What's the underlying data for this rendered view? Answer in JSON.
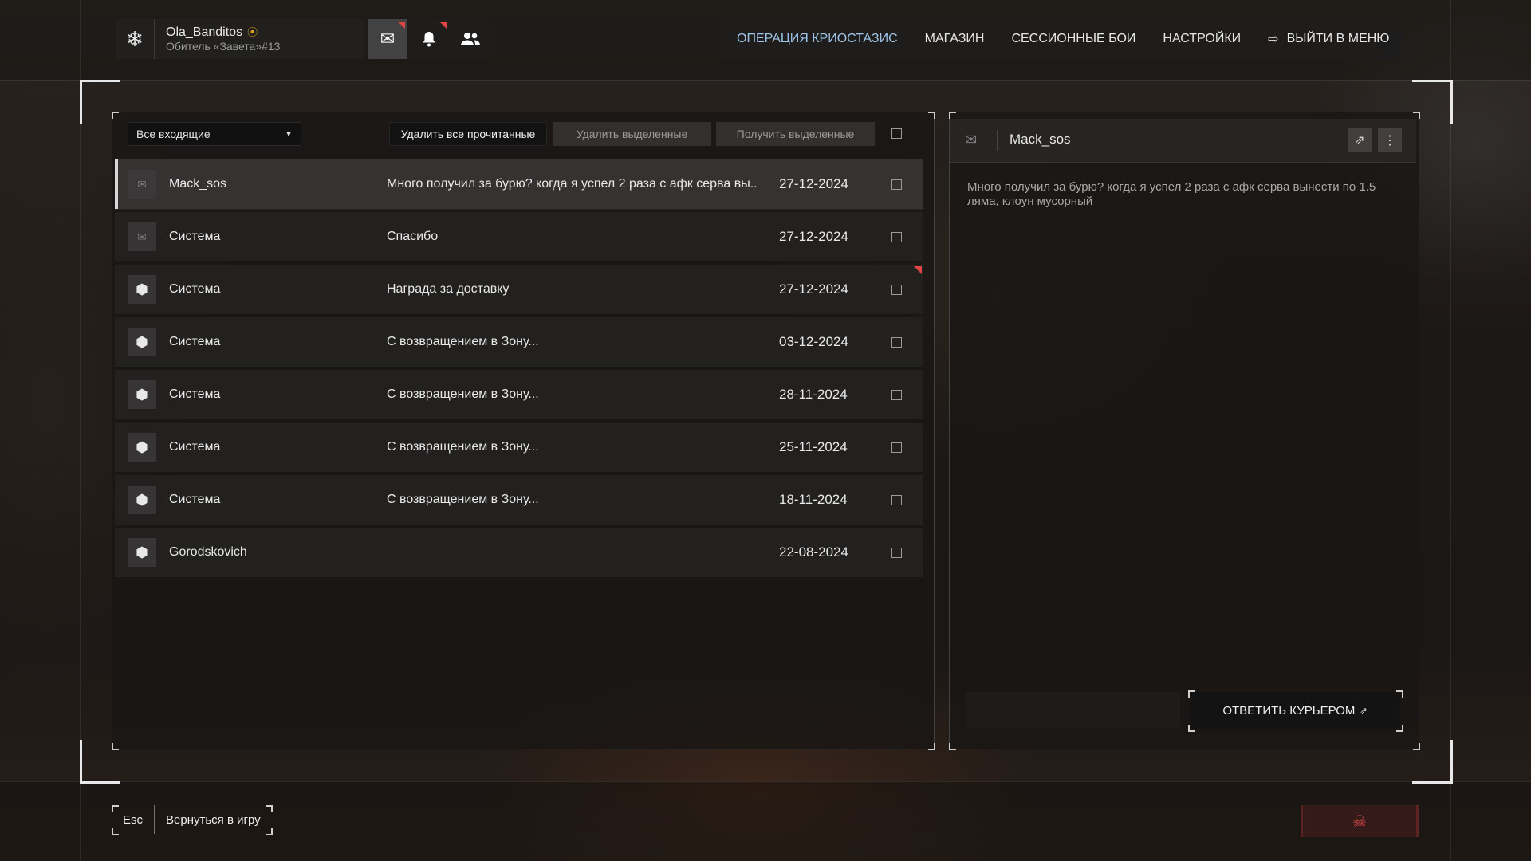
{
  "profile": {
    "emblem_icon": "snowflake-emblem-icon",
    "nickname": "Ola_Banditos",
    "clan": "Обитель «Завета»#13"
  },
  "header_icons": {
    "mail": "envelope-icon",
    "notifications": "bell-icon",
    "friends": "users-icon"
  },
  "nav": {
    "items": [
      {
        "label": "ОПЕРАЦИЯ КРИОСТАЗИС",
        "active": true
      },
      {
        "label": "МАГАЗИН"
      },
      {
        "label": "СЕССИОННЫЕ БОИ"
      },
      {
        "label": "НАСТРОЙКИ"
      },
      {
        "label": "ВЫЙТИ В МЕНЮ"
      }
    ]
  },
  "mail": {
    "filter": "Все входящие",
    "delete_read": "Удалить все прочитанные",
    "delete_selected": "Удалить выделенные",
    "receive_selected": "Получить выделенные",
    "rows": [
      {
        "sender": "Mack_sos",
        "subject": "Много получил за бурю? когда я успел 2 раза с афк серва вы..",
        "date": "27-12-2024",
        "icon": "envelope-icon",
        "selected": true
      },
      {
        "sender": "Система",
        "subject": "Спасибо",
        "date": "27-12-2024",
        "icon": "envelope-icon"
      },
      {
        "sender": "Система",
        "subject": "Награда за доставку",
        "date": "27-12-2024",
        "icon": "package-icon",
        "new": true
      },
      {
        "sender": "Система",
        "subject": "С возвращением в Зону...",
        "date": "03-12-2024",
        "icon": "package-icon"
      },
      {
        "sender": "Система",
        "subject": "С возвращением в Зону...",
        "date": "28-11-2024",
        "icon": "package-icon"
      },
      {
        "sender": "Система",
        "subject": "С возвращением в Зону...",
        "date": "25-11-2024",
        "icon": "package-icon"
      },
      {
        "sender": "Система",
        "subject": "С возвращением в Зону...",
        "date": "18-11-2024",
        "icon": "package-icon"
      },
      {
        "sender": "Gorodskovich",
        "subject": "",
        "date": "22-08-2024",
        "icon": "package-icon"
      }
    ]
  },
  "reader": {
    "from": "Mack_sos",
    "body": "Много получил за бурю? когда я успел 2 раза с афк серва вынести по 1.5 ляма, клоун мусорный",
    "reply_button": "ОТВЕТИТЬ КУРЬЕРОМ"
  },
  "footer": {
    "esc_key": "Esc",
    "esc_label": "Вернуться в игру"
  },
  "colors": {
    "accent_blue": "#9fc3e6",
    "alert_red": "#e14444"
  }
}
